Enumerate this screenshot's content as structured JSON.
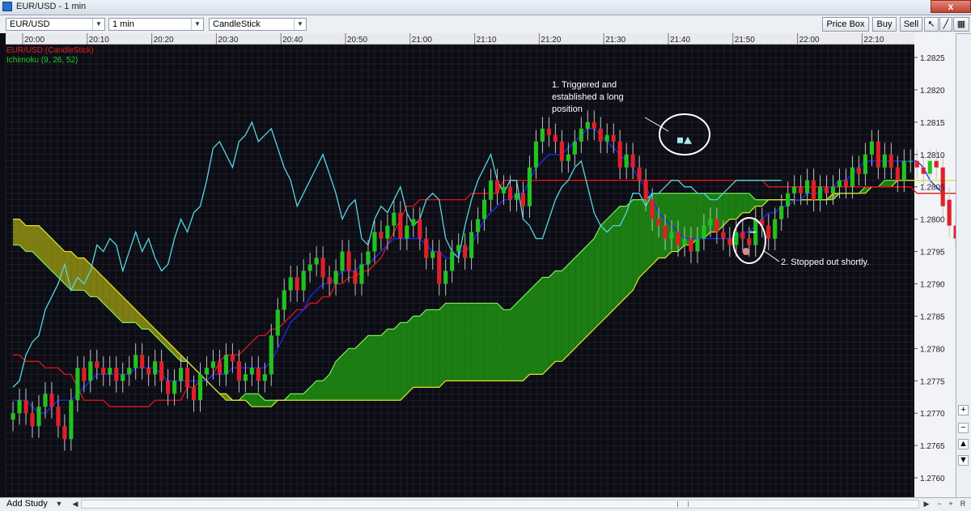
{
  "window": {
    "title": "EUR/USD - 1 min",
    "close_label": "x"
  },
  "toolbar": {
    "symbol": "EUR/USD",
    "interval": "1 min",
    "chart_type": "CandleStick",
    "price_box_label": "Price Box",
    "buy_label": "Buy",
    "sell_label": "Sell"
  },
  "legend": {
    "series_label": "EUR/USD (CandleStick)",
    "indicator_label": "Ichimoku (9, 26, 52)"
  },
  "annotations": {
    "entry_note": [
      "1. Triggered and",
      "established a long",
      "position"
    ],
    "exit_note": "2. Stopped out shortly."
  },
  "statusbar": {
    "add_study_label": "Add Study",
    "r_label": "R"
  },
  "colors": {
    "background": "#0c0c14",
    "grid": "#2a2a38",
    "bull": "#22c21f",
    "bear": "#e0202a",
    "tenkan": "#1a2cff",
    "kijun": "#e01818",
    "chikou": "#56d8e0",
    "kumo_bull": "#1d8a12",
    "kumo_bear": "#8b8a12",
    "span_a": "#7cf05a",
    "span_b": "#e6e630"
  },
  "chart_data": {
    "type": "candlestick",
    "symbol": "EUR/USD",
    "timeframe": "1 min",
    "x_ticks": [
      "20:00",
      "20:10",
      "20:20",
      "20:30",
      "20:40",
      "20:50",
      "21:00",
      "21:10",
      "21:20",
      "21:30",
      "21:40",
      "21:50",
      "22:00",
      "22:10"
    ],
    "y_ticks": [
      "1.2825",
      "1.2820",
      "1.2815",
      "1.2810",
      "1.2805",
      "1.2800",
      "1.2795",
      "1.2790",
      "1.2785",
      "1.2780",
      "1.2775",
      "1.2770",
      "1.2765",
      "1.2760"
    ],
    "ylim": [
      1.2757,
      1.2827
    ],
    "time_start": "19:57",
    "time_per_tick": 1,
    "ichimoku": {
      "tenkan": 9,
      "kijun": 26,
      "senkou": 52
    },
    "close": [
      1.277,
      1.2772,
      1.277,
      1.2768,
      1.2771,
      1.2773,
      1.2771,
      1.2768,
      1.2766,
      1.2772,
      1.2777,
      1.2775,
      1.2778,
      1.2777,
      1.2776,
      1.2777,
      1.2775,
      1.2776,
      1.2777,
      1.2779,
      1.2777,
      1.2776,
      1.2778,
      1.2775,
      1.2773,
      1.2775,
      1.2777,
      1.2774,
      1.2772,
      1.2776,
      1.2777,
      1.2778,
      1.2776,
      1.2779,
      1.2778,
      1.2775,
      1.2776,
      1.2777,
      1.2775,
      1.2776,
      1.2782,
      1.2786,
      1.2789,
      1.2791,
      1.2789,
      1.2792,
      1.2793,
      1.2794,
      1.2791,
      1.279,
      1.2792,
      1.2795,
      1.2792,
      1.279,
      1.2793,
      1.2795,
      1.2798,
      1.2797,
      1.2799,
      1.2801,
      1.2797,
      1.2799,
      1.28,
      1.2797,
      1.2794,
      1.2795,
      1.279,
      1.2792,
      1.2795,
      1.2796,
      1.2794,
      1.2798,
      1.28,
      1.2803,
      1.2806,
      1.2804,
      1.2805,
      1.2803,
      1.2804,
      1.2802,
      1.2808,
      1.2812,
      1.2814,
      1.2813,
      1.2812,
      1.2809,
      1.281,
      1.2812,
      1.2814,
      1.2815,
      1.2814,
      1.2812,
      1.2813,
      1.2812,
      1.2808,
      1.281,
      1.2808,
      1.2806,
      1.2803,
      1.28,
      1.2799,
      1.2797,
      1.2798,
      1.2796,
      1.2797,
      1.2795,
      1.2797,
      1.2799,
      1.28,
      1.2798,
      1.2797,
      1.2796,
      1.2798,
      1.2797,
      1.2796,
      1.28,
      1.2799,
      1.2797,
      1.28,
      1.2802,
      1.2804,
      1.2805,
      1.2804,
      1.2806,
      1.2803,
      1.2805,
      1.2804,
      1.2805,
      1.2806,
      1.2805,
      1.2808,
      1.2807,
      1.281,
      1.2812,
      1.2808,
      1.281,
      1.2808,
      1.2806,
      1.2809,
      1.2809,
      1.2808,
      1.2807,
      1.2809,
      1.2808,
      1.2802,
      1.2799,
      1.2797
    ],
    "open": [
      1.2769,
      1.277,
      1.2772,
      1.277,
      1.2768,
      1.2771,
      1.2773,
      1.2771,
      1.2768,
      1.2766,
      1.2772,
      1.2777,
      1.2775,
      1.2778,
      1.2777,
      1.2776,
      1.2777,
      1.2775,
      1.2776,
      1.2777,
      1.2779,
      1.2777,
      1.2776,
      1.2778,
      1.2775,
      1.2773,
      1.2775,
      1.2777,
      1.2774,
      1.2772,
      1.2776,
      1.2777,
      1.2778,
      1.2776,
      1.2779,
      1.2778,
      1.2775,
      1.2776,
      1.2777,
      1.2775,
      1.2776,
      1.2782,
      1.2786,
      1.2789,
      1.2791,
      1.2789,
      1.2792,
      1.2793,
      1.2794,
      1.2791,
      1.279,
      1.2792,
      1.2795,
      1.2792,
      1.279,
      1.2793,
      1.2795,
      1.2798,
      1.2797,
      1.2799,
      1.2801,
      1.2797,
      1.2799,
      1.28,
      1.2797,
      1.2794,
      1.2795,
      1.279,
      1.2792,
      1.2795,
      1.2796,
      1.2794,
      1.2798,
      1.28,
      1.2803,
      1.2806,
      1.2804,
      1.2805,
      1.2803,
      1.2804,
      1.2802,
      1.2808,
      1.2812,
      1.2814,
      1.2813,
      1.2812,
      1.2809,
      1.281,
      1.2812,
      1.2814,
      1.2815,
      1.2814,
      1.2812,
      1.2813,
      1.2812,
      1.2808,
      1.281,
      1.2808,
      1.2806,
      1.2803,
      1.28,
      1.2799,
      1.2797,
      1.2798,
      1.2796,
      1.2797,
      1.2795,
      1.2797,
      1.2799,
      1.28,
      1.2798,
      1.2797,
      1.2796,
      1.2798,
      1.2797,
      1.2796,
      1.28,
      1.2799,
      1.2797,
      1.28,
      1.2802,
      1.2804,
      1.2805,
      1.2804,
      1.2806,
      1.2803,
      1.2805,
      1.2804,
      1.2805,
      1.2806,
      1.2805,
      1.2808,
      1.2807,
      1.281,
      1.2812,
      1.2808,
      1.281,
      1.2808,
      1.2806,
      1.2809,
      1.2809,
      1.2808,
      1.2807,
      1.2809,
      1.2808,
      1.2803,
      1.2799
    ],
    "tenkan": [
      1.2772,
      1.2772,
      1.2772,
      1.2771,
      1.277,
      1.277,
      1.2771,
      1.2772,
      1.2772,
      1.2772,
      1.2773,
      1.2774,
      1.2775,
      1.2776,
      1.2776,
      1.2776,
      1.2776,
      1.2776,
      1.2776,
      1.2777,
      1.2777,
      1.2777,
      1.2777,
      1.2776,
      1.2775,
      1.2775,
      1.2775,
      1.2775,
      1.2775,
      1.2775,
      1.2775,
      1.2776,
      1.2776,
      1.2776,
      1.2777,
      1.2777,
      1.2777,
      1.2777,
      1.2777,
      1.2777,
      1.2778,
      1.278,
      1.2782,
      1.2784,
      1.2785,
      1.2786,
      1.2788,
      1.2789,
      1.279,
      1.279,
      1.2791,
      1.2792,
      1.2792,
      1.2792,
      1.2793,
      1.2793,
      1.2794,
      1.2795,
      1.2796,
      1.2797,
      1.2797,
      1.2797,
      1.2797,
      1.2797,
      1.2796,
      1.2795,
      1.2795,
      1.2794,
      1.2794,
      1.2795,
      1.2795,
      1.2796,
      1.2798,
      1.28,
      1.2801,
      1.2802,
      1.2803,
      1.2803,
      1.2804,
      1.2804,
      1.2806,
      1.2808,
      1.2809,
      1.281,
      1.281,
      1.281,
      1.2811,
      1.2812,
      1.2813,
      1.2814,
      1.2814,
      1.2813,
      1.2812,
      1.2811,
      1.281,
      1.2809,
      1.2808,
      1.2806,
      1.2805,
      1.2803,
      1.2801,
      1.28,
      1.2799,
      1.2798,
      1.2797,
      1.2797,
      1.2797,
      1.2797,
      1.2797,
      1.2797,
      1.2797,
      1.2797,
      1.2797,
      1.2798,
      1.2798,
      1.2799,
      1.28,
      1.2801,
      1.2801,
      1.2802,
      1.2802,
      1.2803,
      1.2803,
      1.2804,
      1.2804,
      1.2804,
      1.2805,
      1.2805,
      1.2806,
      1.2806,
      1.2807,
      1.2808,
      1.2809,
      1.2809,
      1.2809,
      1.2809,
      1.2809,
      1.2809,
      1.2809,
      1.2809,
      1.2809,
      1.2808,
      1.2806,
      1.2805,
      1.2804
    ],
    "kijun": [
      1.2779,
      1.2779,
      1.2778,
      1.2778,
      1.2778,
      1.2777,
      1.2777,
      1.2777,
      1.2776,
      1.2776,
      1.2774,
      1.2772,
      1.2772,
      1.2772,
      1.2772,
      1.2771,
      1.2771,
      1.2771,
      1.2771,
      1.2771,
      1.2771,
      1.2771,
      1.2772,
      1.2772,
      1.2772,
      1.2772,
      1.2772,
      1.2774,
      1.2774,
      1.2775,
      1.2775,
      1.2776,
      1.2778,
      1.2779,
      1.2779,
      1.2779,
      1.278,
      1.2781,
      1.2782,
      1.2782,
      1.2783,
      1.2783,
      1.2784,
      1.2785,
      1.2786,
      1.2786,
      1.2787,
      1.2787,
      1.2788,
      1.2788,
      1.279,
      1.279,
      1.2791,
      1.2791,
      1.2792,
      1.2792,
      1.2793,
      1.2794,
      1.2796,
      1.2798,
      1.28,
      1.2802,
      1.2802,
      1.2803,
      1.2803,
      1.2803,
      1.2803,
      1.2803,
      1.2803,
      1.2803,
      1.2803,
      1.2804,
      1.2804,
      1.2804,
      1.2804,
      1.2804,
      1.2806,
      1.2806,
      1.2806,
      1.2806,
      1.2806,
      1.2806,
      1.2806,
      1.2806,
      1.2806,
      1.2806,
      1.2806,
      1.2806,
      1.2806,
      1.2806,
      1.2806,
      1.2806,
      1.2806,
      1.2806,
      1.2806,
      1.2806,
      1.2806,
      1.2806,
      1.2806,
      1.2806,
      1.2806,
      1.2806,
      1.2806,
      1.2806,
      1.2806,
      1.2806,
      1.2806,
      1.2806,
      1.2806,
      1.2806,
      1.2806,
      1.2806,
      1.2806,
      1.2806,
      1.2806,
      1.2806,
      1.2806,
      1.2805,
      1.2805,
      1.2805,
      1.2805,
      1.2805,
      1.2805,
      1.2805,
      1.2805,
      1.2805,
      1.2805,
      1.2805,
      1.2805,
      1.2805,
      1.2805,
      1.2805,
      1.2805,
      1.2805,
      1.2805,
      1.2805,
      1.2805,
      1.2805,
      1.2805,
      1.2805,
      1.2804,
      1.2804,
      1.2804,
      1.2804,
      1.2804,
      1.2804,
      1.2804
    ],
    "span_a": [
      1.2796,
      1.2796,
      1.2795,
      1.2795,
      1.2794,
      1.2793,
      1.2792,
      1.2791,
      1.279,
      1.2789,
      1.2789,
      1.2789,
      1.2788,
      1.2788,
      1.2787,
      1.2786,
      1.2785,
      1.2784,
      1.2784,
      1.2784,
      1.2783,
      1.2783,
      1.2782,
      1.2781,
      1.278,
      1.2779,
      1.2778,
      1.2778,
      1.2777,
      1.2776,
      1.2775,
      1.2774,
      1.2773,
      1.2772,
      1.2772,
      1.2772,
      1.2773,
      1.2773,
      1.2773,
      1.2772,
      1.2772,
      1.2772,
      1.2772,
      1.2773,
      1.2773,
      1.2773,
      1.2774,
      1.2775,
      1.2775,
      1.2776,
      1.2778,
      1.2779,
      1.278,
      1.278,
      1.2781,
      1.2782,
      1.2782,
      1.2782,
      1.2783,
      1.2783,
      1.2784,
      1.2784,
      1.2785,
      1.2785,
      1.2786,
      1.2786,
      1.2786,
      1.2787,
      1.2787,
      1.2787,
      1.2787,
      1.2787,
      1.2787,
      1.2787,
      1.2787,
      1.2787,
      1.2786,
      1.2786,
      1.2787,
      1.2788,
      1.2789,
      1.279,
      1.2791,
      1.2791,
      1.2792,
      1.2792,
      1.2793,
      1.2794,
      1.2795,
      1.2796,
      1.2797,
      1.2799,
      1.28,
      1.2801,
      1.2802,
      1.2802,
      1.2803,
      1.2803,
      1.2803,
      1.2804,
      1.2804,
      1.2804,
      1.2804,
      1.2804,
      1.2804,
      1.2804,
      1.2804,
      1.2804,
      1.2804,
      1.2804,
      1.2804,
      1.2804,
      1.2804,
      1.2804,
      1.2804,
      1.2803,
      1.2803,
      1.2803,
      1.2803,
      1.2803,
      1.2803,
      1.2803,
      1.2803,
      1.2803,
      1.2803,
      1.2803,
      1.2803,
      1.2803,
      1.2804,
      1.2804,
      1.2804,
      1.2804,
      1.2805,
      1.2805,
      1.2805,
      1.2806,
      1.2806,
      1.2806,
      1.2806,
      1.2806,
      1.2806,
      1.2806,
      1.2806,
      1.2806,
      1.2806,
      1.2806,
      1.2806,
      1.2806,
      1.2806,
      1.2805
    ],
    "span_b": [
      1.28,
      1.28,
      1.2799,
      1.2799,
      1.2799,
      1.2798,
      1.2797,
      1.2796,
      1.2795,
      1.2795,
      1.2794,
      1.2794,
      1.2793,
      1.2792,
      1.2791,
      1.279,
      1.2789,
      1.2788,
      1.2787,
      1.2786,
      1.2785,
      1.2784,
      1.2783,
      1.2782,
      1.2781,
      1.278,
      1.2779,
      1.2778,
      1.2777,
      1.2776,
      1.2775,
      1.2774,
      1.2773,
      1.2773,
      1.2772,
      1.2772,
      1.2772,
      1.2771,
      1.2771,
      1.2771,
      1.2771,
      1.2772,
      1.2772,
      1.2772,
      1.2772,
      1.2772,
      1.2772,
      1.2772,
      1.2772,
      1.2772,
      1.2772,
      1.2772,
      1.2772,
      1.2772,
      1.2772,
      1.2772,
      1.2772,
      1.2772,
      1.2772,
      1.2772,
      1.2772,
      1.2773,
      1.2774,
      1.2774,
      1.2774,
      1.2774,
      1.2774,
      1.2775,
      1.2775,
      1.2775,
      1.2775,
      1.2775,
      1.2775,
      1.2775,
      1.2775,
      1.2775,
      1.2775,
      1.2775,
      1.2775,
      1.2775,
      1.2776,
      1.2776,
      1.2776,
      1.2777,
      1.2778,
      1.2778,
      1.2779,
      1.278,
      1.2781,
      1.2782,
      1.2783,
      1.2784,
      1.2785,
      1.2786,
      1.2787,
      1.2788,
      1.2789,
      1.2791,
      1.2792,
      1.2793,
      1.2794,
      1.2794,
      1.2795,
      1.2795,
      1.2796,
      1.2796,
      1.2797,
      1.2797,
      1.2798,
      1.2798,
      1.2799,
      1.28,
      1.28,
      1.2801,
      1.2801,
      1.2802,
      1.2802,
      1.2803,
      1.2803,
      1.2803,
      1.2803,
      1.2803,
      1.2803,
      1.2803,
      1.2803,
      1.2803,
      1.2803,
      1.2804,
      1.2804,
      1.2804,
      1.2804,
      1.2804,
      1.2804,
      1.2805,
      1.2805,
      1.2805,
      1.2805,
      1.2806,
      1.2806,
      1.2806,
      1.2806,
      1.2806,
      1.2806,
      1.2806,
      1.2806,
      1.2806,
      1.2806,
      1.2806,
      1.2806,
      1.2806,
      1.2806,
      1.2806
    ],
    "chikou": [
      1.2774,
      1.2775,
      1.2779,
      1.2781,
      1.2782,
      1.2786,
      1.2788,
      1.279,
      1.2793,
      1.2789,
      1.2791,
      1.279,
      1.2792,
      1.2796,
      1.2795,
      1.2797,
      1.2796,
      1.2792,
      1.2795,
      1.2798,
      1.2795,
      1.2797,
      1.2794,
      1.2792,
      1.2793,
      1.2797,
      1.28,
      1.2798,
      1.2801,
      1.2802,
      1.2806,
      1.2811,
      1.2812,
      1.281,
      1.2808,
      1.2812,
      1.2813,
      1.2815,
      1.2812,
      1.2813,
      1.2814,
      1.2811,
      1.2808,
      1.2806,
      1.2802,
      1.2804,
      1.2806,
      1.2808,
      1.281,
      1.2807,
      1.2804,
      1.28,
      1.2802,
      1.2803,
      1.2797,
      1.2796,
      1.28,
      1.2802,
      1.2801,
      1.2803,
      1.2805,
      1.2801,
      1.2799,
      1.28,
      1.2803,
      1.2804,
      1.2803,
      1.2797,
      1.2795,
      1.2794,
      1.2799,
      1.2803,
      1.2806,
      1.2808,
      1.281,
      1.2806,
      1.2804,
      1.2806,
      1.2806,
      1.28,
      1.2799,
      1.2797,
      1.2797,
      1.28,
      1.2803,
      1.2805,
      1.2806,
      1.2808,
      1.2809,
      1.2805,
      1.2801,
      1.2799,
      1.2798,
      1.2799,
      1.2799,
      1.2801,
      1.2804,
      1.2804,
      1.2802,
      1.2804,
      1.2804,
      1.2805,
      1.2806,
      1.2806,
      1.2805,
      1.2805,
      1.2804,
      1.2804,
      1.2803,
      1.2803,
      1.2804,
      1.2805,
      1.2806,
      1.2806,
      1.2806,
      1.2806,
      1.2806,
      1.2806,
      1.2806,
      1.2806
    ],
    "entry_marker_price": 1.2812,
    "exit_marker_price": 1.2795,
    "exit_dash_price": 1.2798
  }
}
